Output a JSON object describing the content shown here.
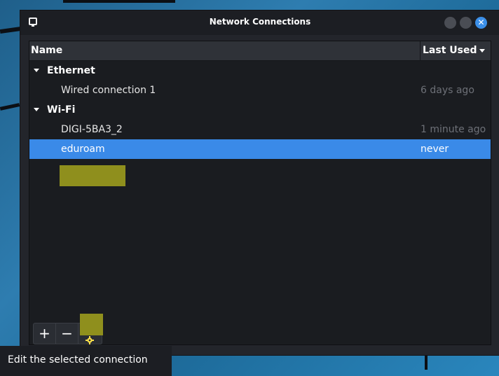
{
  "window": {
    "title": "Network Connections",
    "close_glyph": "✕"
  },
  "table": {
    "col_name": "Name",
    "col_last_used": "Last Used",
    "groups": [
      {
        "label": "Ethernet",
        "items": [
          {
            "name": "Wired connection 1",
            "last_used": "6 days ago",
            "selected": false
          }
        ]
      },
      {
        "label": "Wi-Fi",
        "items": [
          {
            "name": "DIGI-5BA3_2",
            "last_used": "1 minute ago",
            "selected": false
          },
          {
            "name": "eduroam",
            "last_used": "never",
            "selected": true
          }
        ]
      }
    ]
  },
  "toolbar": {
    "add_label": "+",
    "remove_label": "−",
    "edit_icon": "gear-icon"
  },
  "tooltip": {
    "text": "Edit the selected connection"
  },
  "colors": {
    "selection": "#3a8ae8",
    "highlight": "#8f8f1d",
    "window_bg": "#23252b",
    "desktop": "#2b6f98"
  }
}
